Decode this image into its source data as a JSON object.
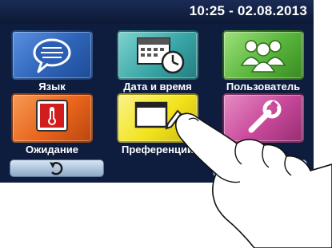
{
  "status_bar": {
    "datetime": "10:25 - 02.08.2013"
  },
  "tiles": [
    {
      "label": "Язык",
      "icon": "speech-bubble-icon",
      "color": "#2e64b8"
    },
    {
      "label": "Дата и время",
      "icon": "calendar-clock-icon",
      "color": "#3aa7a8"
    },
    {
      "label": "Пользователь",
      "icon": "users-icon",
      "color": "#58b53b"
    },
    {
      "label": "Ожидание",
      "icon": "thermometer-icon",
      "color": "#e9641c"
    },
    {
      "label": "Преференции",
      "icon": "window-pencil-icon",
      "color": "#f2e31c"
    },
    {
      "label": "",
      "icon": "wrench-icon",
      "color": "#c8489a"
    }
  ],
  "nav": {
    "back_icon": "undo-arrow-icon"
  }
}
